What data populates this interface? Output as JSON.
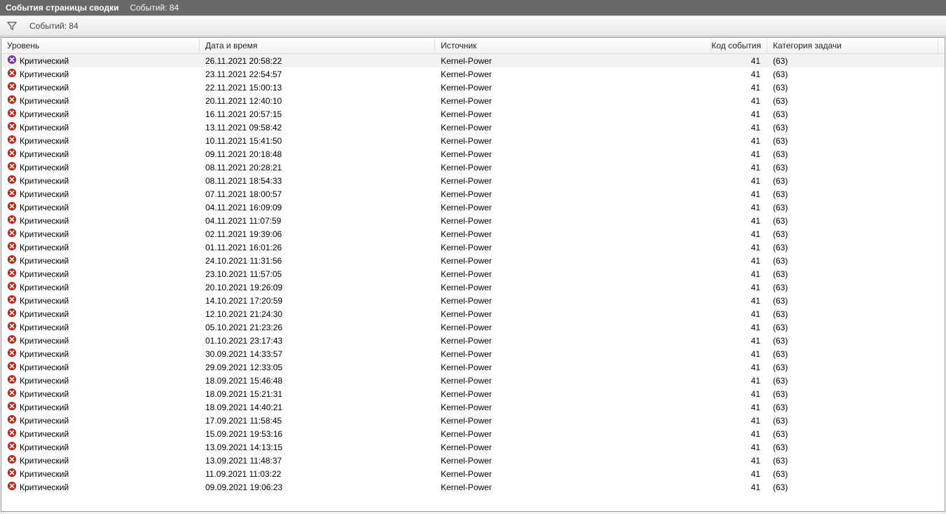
{
  "titlebar": {
    "title": "События страницы сводки",
    "count_label": "Событий: 84"
  },
  "filterbar": {
    "count_label": "Событий: 84"
  },
  "columns": {
    "level": "Уровень",
    "datetime": "Дата и время",
    "source": "Источник",
    "event_id": "Код события",
    "category": "Категория задачи"
  },
  "rows": [
    {
      "selected": true,
      "level": "Критический",
      "datetime": "26.11.2021 20:58:22",
      "source": "Kernel-Power",
      "event_id": "41",
      "category": "(63)"
    },
    {
      "selected": false,
      "level": "Критический",
      "datetime": "23.11.2021 22:54:57",
      "source": "Kernel-Power",
      "event_id": "41",
      "category": "(63)"
    },
    {
      "selected": false,
      "level": "Критический",
      "datetime": "22.11.2021 15:00:13",
      "source": "Kernel-Power",
      "event_id": "41",
      "category": "(63)"
    },
    {
      "selected": false,
      "level": "Критический",
      "datetime": "20.11.2021 12:40:10",
      "source": "Kernel-Power",
      "event_id": "41",
      "category": "(63)"
    },
    {
      "selected": false,
      "level": "Критический",
      "datetime": "16.11.2021 20:57:15",
      "source": "Kernel-Power",
      "event_id": "41",
      "category": "(63)"
    },
    {
      "selected": false,
      "level": "Критический",
      "datetime": "13.11.2021 09:58:42",
      "source": "Kernel-Power",
      "event_id": "41",
      "category": "(63)"
    },
    {
      "selected": false,
      "level": "Критический",
      "datetime": "10.11.2021 15:41:50",
      "source": "Kernel-Power",
      "event_id": "41",
      "category": "(63)"
    },
    {
      "selected": false,
      "level": "Критический",
      "datetime": "09.11.2021 20:18:48",
      "source": "Kernel-Power",
      "event_id": "41",
      "category": "(63)"
    },
    {
      "selected": false,
      "level": "Критический",
      "datetime": "08.11.2021 20:28:21",
      "source": "Kernel-Power",
      "event_id": "41",
      "category": "(63)"
    },
    {
      "selected": false,
      "level": "Критический",
      "datetime": "08.11.2021 18:54:33",
      "source": "Kernel-Power",
      "event_id": "41",
      "category": "(63)"
    },
    {
      "selected": false,
      "level": "Критический",
      "datetime": "07.11.2021 18:00:57",
      "source": "Kernel-Power",
      "event_id": "41",
      "category": "(63)"
    },
    {
      "selected": false,
      "level": "Критический",
      "datetime": "04.11.2021 16:09:09",
      "source": "Kernel-Power",
      "event_id": "41",
      "category": "(63)"
    },
    {
      "selected": false,
      "level": "Критический",
      "datetime": "04.11.2021 11:07:59",
      "source": "Kernel-Power",
      "event_id": "41",
      "category": "(63)"
    },
    {
      "selected": false,
      "level": "Критический",
      "datetime": "02.11.2021 19:39:06",
      "source": "Kernel-Power",
      "event_id": "41",
      "category": "(63)"
    },
    {
      "selected": false,
      "level": "Критический",
      "datetime": "01.11.2021 16:01:26",
      "source": "Kernel-Power",
      "event_id": "41",
      "category": "(63)"
    },
    {
      "selected": false,
      "level": "Критический",
      "datetime": "24.10.2021 11:31:56",
      "source": "Kernel-Power",
      "event_id": "41",
      "category": "(63)"
    },
    {
      "selected": false,
      "level": "Критический",
      "datetime": "23.10.2021 11:57:05",
      "source": "Kernel-Power",
      "event_id": "41",
      "category": "(63)"
    },
    {
      "selected": false,
      "level": "Критический",
      "datetime": "20.10.2021 19:26:09",
      "source": "Kernel-Power",
      "event_id": "41",
      "category": "(63)"
    },
    {
      "selected": false,
      "level": "Критический",
      "datetime": "14.10.2021 17:20:59",
      "source": "Kernel-Power",
      "event_id": "41",
      "category": "(63)"
    },
    {
      "selected": false,
      "level": "Критический",
      "datetime": "12.10.2021 21:24:30",
      "source": "Kernel-Power",
      "event_id": "41",
      "category": "(63)"
    },
    {
      "selected": false,
      "level": "Критический",
      "datetime": "05.10.2021 21:23:26",
      "source": "Kernel-Power",
      "event_id": "41",
      "category": "(63)"
    },
    {
      "selected": false,
      "level": "Критический",
      "datetime": "01.10.2021 23:17:43",
      "source": "Kernel-Power",
      "event_id": "41",
      "category": "(63)"
    },
    {
      "selected": false,
      "level": "Критический",
      "datetime": "30.09.2021 14:33:57",
      "source": "Kernel-Power",
      "event_id": "41",
      "category": "(63)"
    },
    {
      "selected": false,
      "level": "Критический",
      "datetime": "29.09.2021 12:33:05",
      "source": "Kernel-Power",
      "event_id": "41",
      "category": "(63)"
    },
    {
      "selected": false,
      "level": "Критический",
      "datetime": "18.09.2021 15:46:48",
      "source": "Kernel-Power",
      "event_id": "41",
      "category": "(63)"
    },
    {
      "selected": false,
      "level": "Критический",
      "datetime": "18.09.2021 15:21:31",
      "source": "Kernel-Power",
      "event_id": "41",
      "category": "(63)"
    },
    {
      "selected": false,
      "level": "Критический",
      "datetime": "18.09.2021 14:40:21",
      "source": "Kernel-Power",
      "event_id": "41",
      "category": "(63)"
    },
    {
      "selected": false,
      "level": "Критический",
      "datetime": "17.09.2021 11:58:45",
      "source": "Kernel-Power",
      "event_id": "41",
      "category": "(63)"
    },
    {
      "selected": false,
      "level": "Критический",
      "datetime": "15.09.2021 19:53:16",
      "source": "Kernel-Power",
      "event_id": "41",
      "category": "(63)"
    },
    {
      "selected": false,
      "level": "Критический",
      "datetime": "13.09.2021 14:13:15",
      "source": "Kernel-Power",
      "event_id": "41",
      "category": "(63)"
    },
    {
      "selected": false,
      "level": "Критический",
      "datetime": "13.09.2021 11:48:37",
      "source": "Kernel-Power",
      "event_id": "41",
      "category": "(63)"
    },
    {
      "selected": false,
      "level": "Критический",
      "datetime": "11.09.2021 11:03:22",
      "source": "Kernel-Power",
      "event_id": "41",
      "category": "(63)"
    },
    {
      "selected": false,
      "level": "Критический",
      "datetime": "09.09.2021 19:06:23",
      "source": "Kernel-Power",
      "event_id": "41",
      "category": "(63)"
    }
  ]
}
